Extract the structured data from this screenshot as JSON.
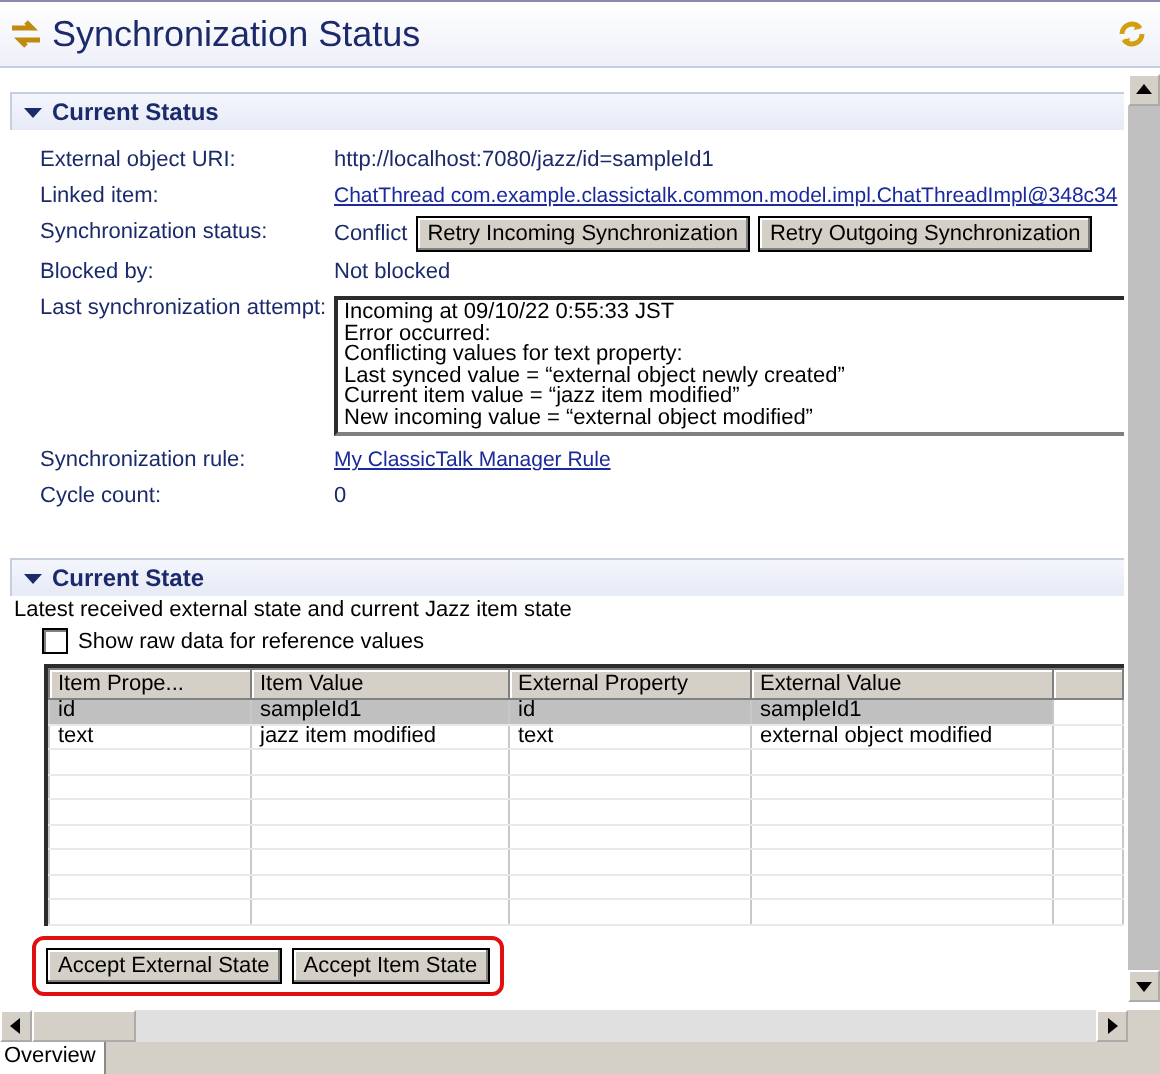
{
  "window": {
    "title": "Synchronization Status"
  },
  "current_status": {
    "title": "Current Status",
    "expanded": true,
    "fields": [
      {
        "kind": "text",
        "label": "External object URI:",
        "value": "http://localhost:7080/jazz/id=sampleId1"
      },
      {
        "kind": "link",
        "label": "Linked item:",
        "value": "ChatThread com.example.classictalk.common.model.impl.ChatThreadImpl@348c34"
      },
      {
        "kind": "status",
        "label": "Synchronization status:",
        "value": "Conflict",
        "buttons": [
          "Retry Incoming Synchronization",
          "Retry Outgoing Synchronization"
        ]
      },
      {
        "kind": "text",
        "label": "Blocked by:",
        "value": "Not blocked"
      },
      {
        "kind": "log",
        "label": "Last synchronization attempt:",
        "lines": [
          "Incoming at 09/10/22 0:55:33 JST",
          "Error occurred:",
          "Conflicting values for text property:",
          "Last synced value = “external object newly created”",
          "Current item value = “jazz item modified”",
          "New incoming value = “external object modified”"
        ]
      },
      {
        "kind": "link",
        "label": "Synchronization rule:",
        "value": "My ClassicTalk Manager Rule"
      },
      {
        "kind": "text",
        "label": "Cycle count:",
        "value": "0"
      }
    ]
  },
  "current_state": {
    "title": "Current State",
    "expanded": true,
    "description": "Latest received external state and current Jazz item state",
    "checkbox": {
      "label": "Show raw data for reference values",
      "checked": false
    },
    "table": {
      "columns": [
        "Item Prope...",
        "Item Value",
        "External Property",
        "External Value"
      ],
      "rows": [
        {
          "cells": [
            "id",
            "sampleId1",
            "id",
            "sampleId1"
          ],
          "selected": true
        },
        {
          "cells": [
            "text",
            "jazz item modified",
            "text",
            "external object modified"
          ],
          "selected": false
        }
      ]
    },
    "buttons": [
      "Accept External State",
      "Accept Item State"
    ]
  },
  "bottom_tabs": [
    {
      "label": "Overview",
      "selected": true
    }
  ]
}
